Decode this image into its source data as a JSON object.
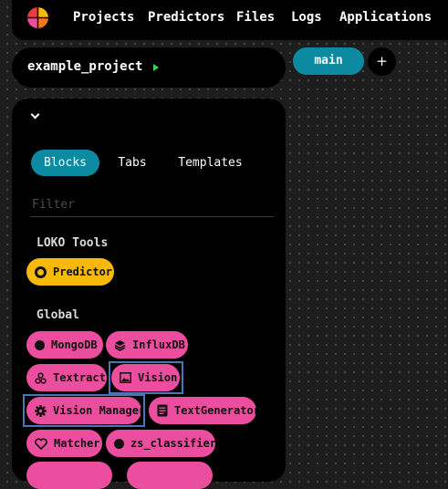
{
  "navbar": {
    "items": [
      "Projects",
      "Predictors",
      "Files",
      "Logs",
      "Applications"
    ],
    "logo_colors": [
      "#f7b90a",
      "#e83e3e",
      "#ec4e9f",
      "#f27a1a"
    ]
  },
  "project": {
    "name": "example_project",
    "run_color": "#39d353"
  },
  "tabs": {
    "active": "main",
    "add_label": "+"
  },
  "panel": {
    "tabs": [
      "Blocks",
      "Tabs",
      "Templates"
    ],
    "filter_placeholder": "Filter",
    "sections": {
      "loko_tools": {
        "title": "LOKO Tools",
        "blocks": [
          {
            "label": "Predictor",
            "icon": "ring-icon"
          }
        ]
      },
      "global": {
        "title": "Global",
        "blocks": [
          {
            "label": "MongoDB",
            "icon": "circle-icon"
          },
          {
            "label": "InfluxDB",
            "icon": "layers-icon"
          },
          {
            "label": "Textract",
            "icon": "shapes-icon"
          },
          {
            "label": "Vision",
            "icon": "image-icon"
          },
          {
            "label": "Vision Manager",
            "icon": "gear-icon"
          },
          {
            "label": "TextGenerator",
            "icon": "document-icon"
          },
          {
            "label": "Matcher",
            "icon": "heart-icon"
          },
          {
            "label": "zs_classifier",
            "icon": "circle-icon"
          }
        ]
      }
    }
  },
  "colors": {
    "accent": "#0c8aa2",
    "block_global": "#ec4e9f",
    "block_tools": "#f7b90a",
    "selection_outline": "#4a76b6"
  }
}
